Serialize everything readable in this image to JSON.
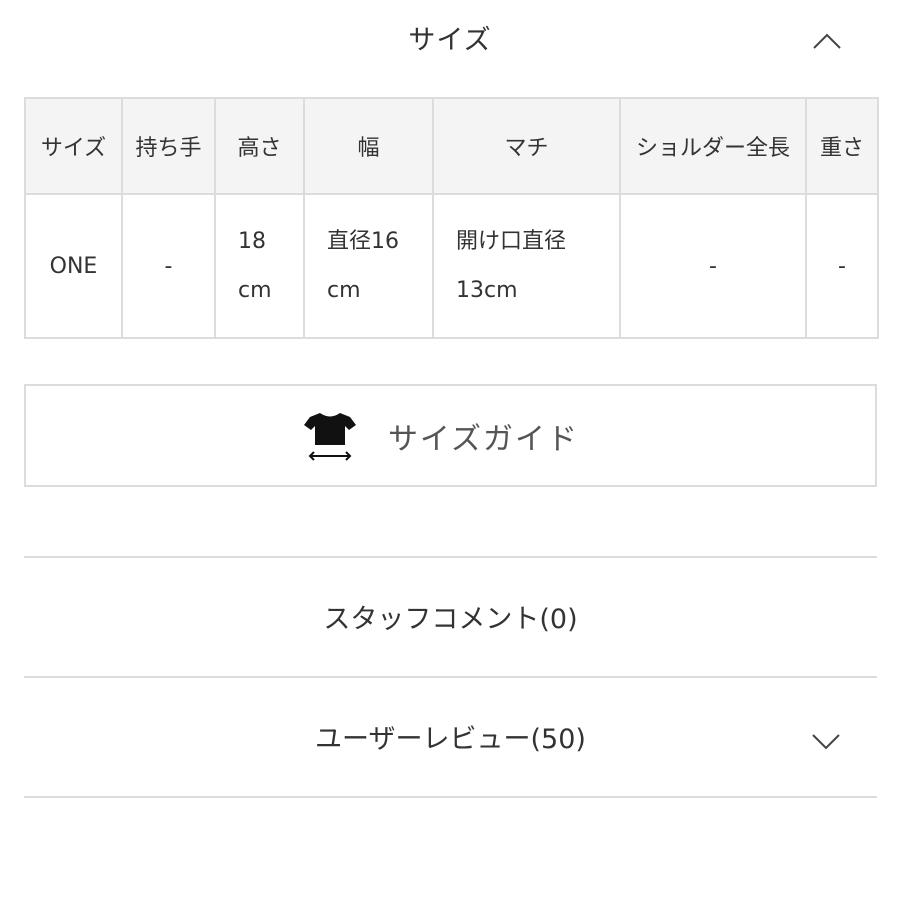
{
  "section": {
    "title": "サイズ",
    "toggle_icon": "chevron-up-icon"
  },
  "size_table": {
    "headers": [
      "サイズ",
      "持ち手",
      "高さ",
      "幅",
      "マチ",
      "ショルダー全長",
      "重さ"
    ],
    "rows": [
      {
        "size": "ONE",
        "handle": "-",
        "height": [
          "18",
          "cm"
        ],
        "width": [
          "直径16",
          "cm"
        ],
        "gusset": [
          "開け口直径",
          "13cm"
        ],
        "shoulder_length": "-",
        "weight": "-"
      }
    ]
  },
  "size_guide": {
    "label": "サイズガイド",
    "icon": "tshirt-measure-icon"
  },
  "accordions": {
    "staff_comment": {
      "label": "スタッフコメント(0)"
    },
    "user_review": {
      "label": "ユーザーレビュー(50)",
      "toggle_icon": "chevron-down-icon"
    }
  },
  "colors": {
    "border": "#dcdcdc",
    "header_bg": "#f4f4f4",
    "text": "#333333"
  }
}
